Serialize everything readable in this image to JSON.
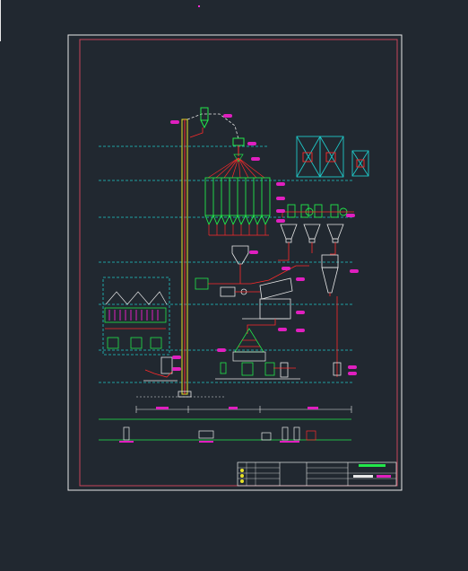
{
  "drawing": {
    "background": "#212830",
    "frame_color": "#c8455a",
    "line_red": "#ff2a2a",
    "line_green": "#22e84a",
    "line_cyan": "#1fc7c7",
    "line_yellow": "#e6e028",
    "line_white": "#e8e8e8",
    "tag_fill": "#e01fbf"
  },
  "cursor": {
    "color": "#ff2bd6"
  }
}
